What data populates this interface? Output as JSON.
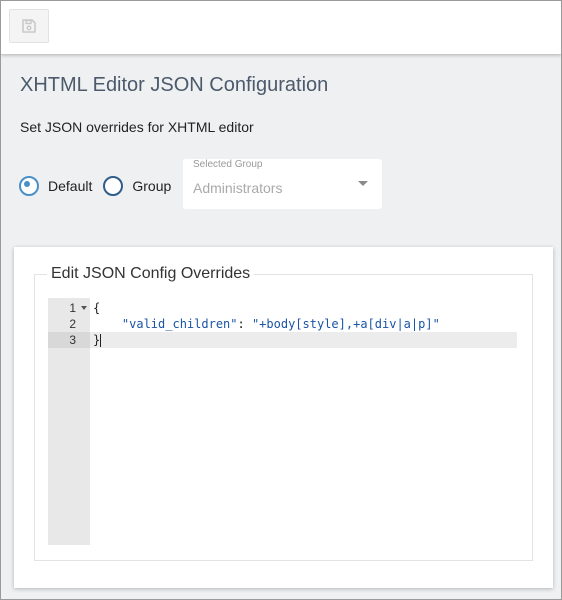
{
  "toolbar": {
    "save_icon": "floppy-disk-icon"
  },
  "page": {
    "title": "XHTML Editor JSON Configuration",
    "subtitle": "Set JSON overrides for XHTML editor"
  },
  "scope": {
    "options": [
      {
        "label": "Default",
        "checked": true
      },
      {
        "label": "Group",
        "checked": false
      }
    ]
  },
  "group_select": {
    "label": "Selected Group",
    "value": "Administrators"
  },
  "editor": {
    "legend": "Edit JSON Config Overrides",
    "lines": [
      {
        "number": "1",
        "text": "{"
      },
      {
        "number": "2",
        "key": "\"valid_children\"",
        "separator": ": ",
        "value": "\"+body[style],+a[div|a|p]\""
      },
      {
        "number": "3",
        "text": "}"
      }
    ],
    "active_line": 3
  },
  "colors": {
    "title": "#4c5a6b",
    "radio_accent": "#4a90c8",
    "string": "#1a55a6",
    "background": "#eef0f2"
  }
}
